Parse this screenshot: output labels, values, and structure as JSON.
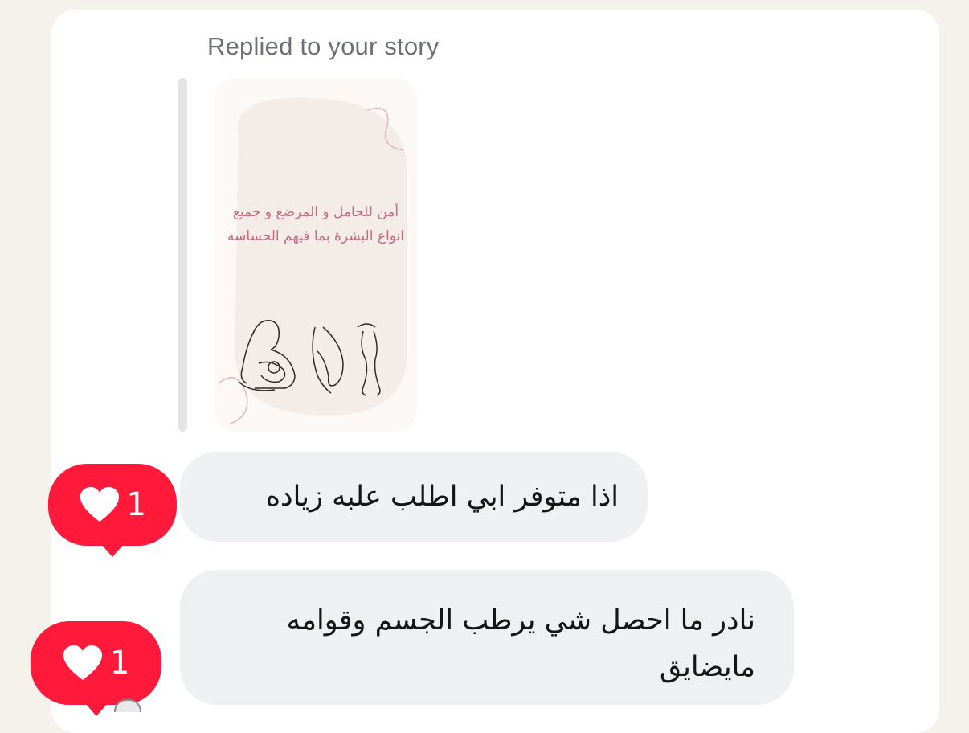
{
  "header": {
    "replied_label": "Replied to your story"
  },
  "story": {
    "caption_line_1": "أمن للحامل و المرضع و جميع",
    "caption_line_2": "انواع البشرة بما فيهم الحساسه",
    "colors": {
      "text": "#c56a86",
      "background": "#fbf8f6"
    }
  },
  "messages": [
    {
      "text": "اذا متوفر ابي اطلب علبه زياده",
      "reaction": {
        "icon": "heart-icon",
        "count": "1"
      }
    },
    {
      "text": "نادر ما احصل شي يرطب الجسم وقوامه مايضايق",
      "reaction": {
        "icon": "heart-icon",
        "count": "1"
      }
    }
  ],
  "colors": {
    "reaction_red": "#ff1a3c",
    "bubble_gray": "#eff0f2",
    "page_background": "#f5f2ec"
  }
}
